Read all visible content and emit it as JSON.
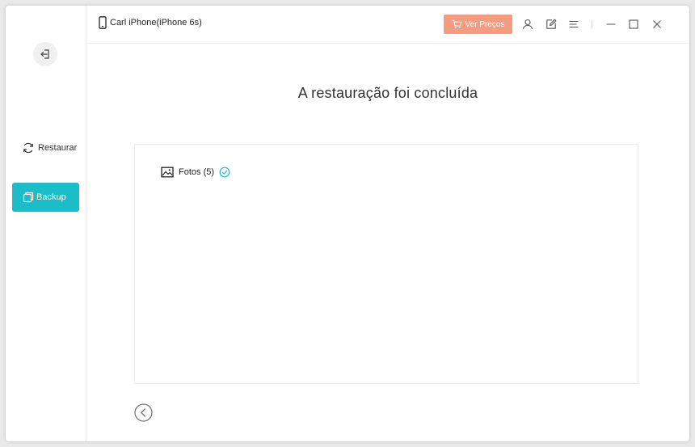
{
  "titlebar": {
    "device_name": "Carl iPhone(iPhone 6s)",
    "buy_label": "Ver Preços"
  },
  "sidebar": {
    "items": [
      {
        "label": "Restaurar",
        "icon": "refresh-icon"
      },
      {
        "label": "Backup",
        "icon": "copy-icon",
        "active": true
      }
    ]
  },
  "main": {
    "headline": "A restauração foi concluída",
    "items": [
      {
        "label": "Fotos (5)",
        "icon": "image-icon",
        "status": "check-circle-icon"
      }
    ]
  },
  "colors": {
    "accent": "#1bbdc9",
    "buy": "#f59b80"
  }
}
